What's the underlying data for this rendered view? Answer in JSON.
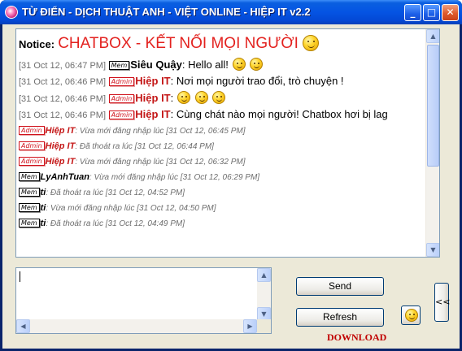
{
  "window": {
    "title": "TỪ ĐIỂN - DỊCH THUẬT ANH - VIỆT ONLINE - HIỆP IT v2.2",
    "minimize_glyph": "_",
    "maximize_glyph": "□",
    "close_glyph": "✕"
  },
  "notice": {
    "label": "Notice:",
    "text": "CHATBOX - KẾT NỐI MỌI NGƯỜI"
  },
  "messages": [
    {
      "time": "[31 Oct 12, 06:47 PM]",
      "badge": "Mem",
      "role": "mem",
      "nick": "Siêu Quậy",
      "text": ": Hello all!",
      "emoticons": 2
    },
    {
      "time": "[31 Oct 12, 06:46 PM]",
      "badge": "Admin",
      "role": "admin",
      "nick": "Hiệp IT",
      "text": ": Nơi mọi người trao đổi, trò chuyện !",
      "emoticons": 0
    },
    {
      "time": "[31 Oct 12, 06:46 PM]",
      "badge": "Admin",
      "role": "admin",
      "nick": "Hiệp IT",
      "text": ":",
      "emoticons": 3
    },
    {
      "time": "[31 Oct 12, 06:46 PM]",
      "badge": "Admin",
      "role": "admin",
      "nick": "Hiệp IT",
      "text": ": Cùng chát nào mọi người! Chatbox hơi bị lag",
      "emoticons": 0
    }
  ],
  "system_events": [
    {
      "badge": "Admin",
      "role": "admin",
      "nick": "Hiệp IT",
      "text": ": Vừa mới đăng nhập lúc [31 Oct 12, 06:45 PM]"
    },
    {
      "badge": "Admin",
      "role": "admin",
      "nick": "Hiệp IT",
      "text": ": Đã thoát ra lúc [31 Oct 12, 06:44 PM]"
    },
    {
      "badge": "Admin",
      "role": "admin",
      "nick": "Hiệp IT",
      "text": ": Vừa mới đăng nhập lúc [31 Oct 12, 06:32 PM]"
    },
    {
      "badge": "Mem",
      "role": "mem",
      "nick": "LyAnhTuan",
      "text": ": Vừa mới đăng nhập lúc [31 Oct 12, 06:29 PM]"
    },
    {
      "badge": "Mem",
      "role": "mem",
      "nick": "ti",
      "text": ": Đã thoát ra lúc [31 Oct 12, 04:52 PM]"
    },
    {
      "badge": "Mem",
      "role": "mem",
      "nick": "ti",
      "text": ": Vừa mới đăng nhập lúc [31 Oct 12, 04:50 PM]"
    },
    {
      "badge": "Mem",
      "role": "mem",
      "nick": "ti",
      "text": ": Đã thoát ra lúc [31 Oct 12, 04:49 PM]"
    }
  ],
  "compose": {
    "value": ""
  },
  "buttons": {
    "send": "Send",
    "refresh": "Refresh",
    "toggle_panel": "<<",
    "download": "DOWNLOAD"
  },
  "colors": {
    "titlebar": "#0554e3",
    "notice_text": "#e3221f",
    "admin_nick": "#c41616",
    "download": "#c00000"
  }
}
